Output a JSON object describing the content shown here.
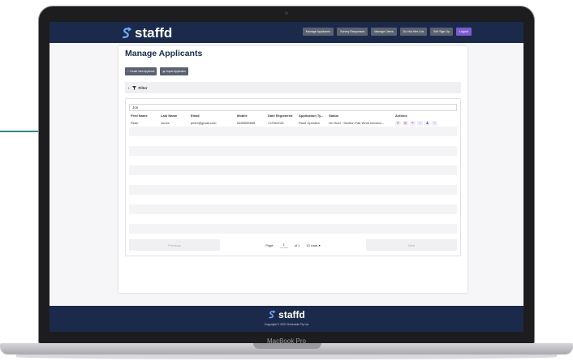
{
  "device": {
    "label": "MacBook Pro"
  },
  "nav": {
    "logo": "staffd",
    "links": [
      "Manage Applicants",
      "Survey Responses",
      "Manage Users",
      "Do Not Hire List",
      "Self Sign Up"
    ],
    "logout": "Logout"
  },
  "page": {
    "title": "Manage Applicants",
    "create_button": "+ Create New Applicant",
    "import_button": "Import Applicants",
    "filter_label": "Filter",
    "search_value": "Jon"
  },
  "table": {
    "columns": [
      "First Name",
      "Last Name",
      "Email",
      "Mobile",
      "Date Registered",
      "Application Ty...",
      "Status",
      "Actions"
    ],
    "rows": [
      [
        "Peter",
        "Jones",
        "peter@gmail.com",
        "0455555555",
        "17/03/2021",
        "Plant Operator",
        "On Hold - Section Fair Work Informa..."
      ]
    ]
  },
  "pagination": {
    "previous": "Previous",
    "page_label": "Page",
    "page_value": "1",
    "of_label": "of 1",
    "rows_label": "10 rows",
    "next": "Next"
  },
  "footer": {
    "logo": "staffd",
    "copyright": "Copyright © 2021 Schedule Pty Ltd"
  },
  "colors": {
    "navy": "#1b2a4a",
    "accent": "#7b5ccf",
    "teal_line": "#2a8a8a"
  }
}
